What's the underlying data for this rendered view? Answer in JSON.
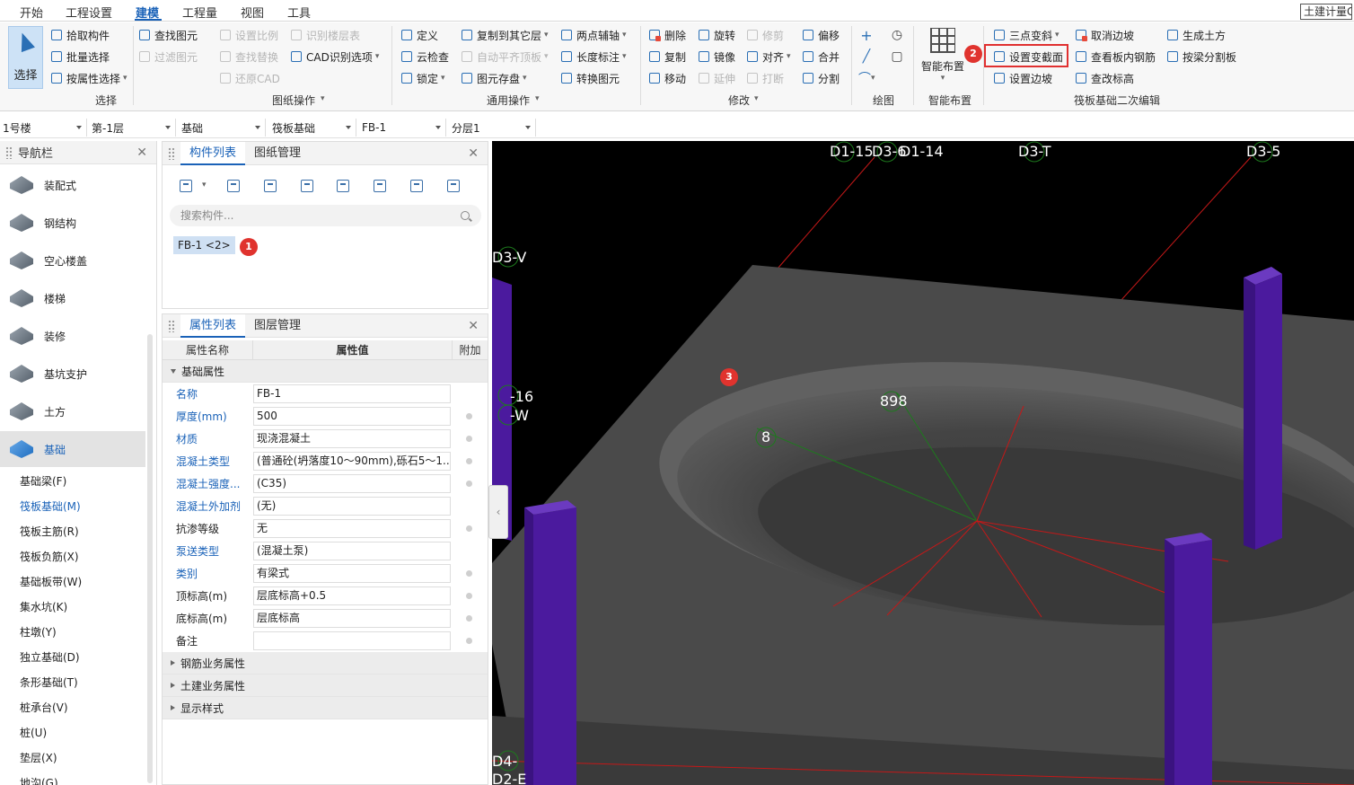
{
  "menu": {
    "tabs": [
      "开始",
      "工程设置",
      "建模",
      "工程量",
      "视图",
      "工具"
    ],
    "active": "建模",
    "right_tab": "土建计量G"
  },
  "ribbon": {
    "select": {
      "big": "选择",
      "pick": "拾取构件",
      "batch": "批量选择",
      "byprop": "按属性选择",
      "label": "选择"
    },
    "drawing": {
      "find_elem": "查找图元",
      "filter_elem": "过滤图元",
      "set_scale": "设置比例",
      "find_replace": "查找替换",
      "restore_cad": "还原CAD",
      "recog_floor": "识别楼层表",
      "cad_options": "CAD识别选项",
      "label": "图纸操作"
    },
    "common": {
      "define": "定义",
      "cloud_check": "云检查",
      "lock": "锁定",
      "copy_other": "复制到其它层",
      "auto_align": "自动平齐顶板",
      "elem_save": "图元存盘",
      "two_point_axis": "两点辅轴",
      "length_dim": "长度标注",
      "convert": "转换图元",
      "label": "通用操作"
    },
    "modify": {
      "delete": "删除",
      "copy": "复制",
      "move": "移动",
      "rotate": "旋转",
      "mirror": "镜像",
      "extend": "延伸",
      "trim": "修剪",
      "align": "对齐",
      "break": "打断",
      "offset": "偏移",
      "merge": "合并",
      "split": "分割",
      "label": "修改"
    },
    "draw": {
      "label": "绘图"
    },
    "smart": {
      "big": "智能布置",
      "label": "智能布置"
    },
    "raft": {
      "three_pt": "三点变斜",
      "set_section": "设置变截面",
      "set_slope": "设置边坡",
      "cancel_slope": "取消边坡",
      "view_rebar": "查看板内钢筋",
      "edit_elev": "查改标高",
      "gen_earth": "生成土方",
      "split_beam": "按梁分割板",
      "label": "筏板基础二次编辑"
    }
  },
  "floorbar": [
    "1号楼",
    "第-1层",
    "基础",
    "筏板基础",
    "FB-1",
    "分层1"
  ],
  "nav": {
    "title": "导航栏",
    "items": [
      "装配式",
      "钢结构",
      "空心楼盖",
      "楼梯",
      "装修",
      "基坑支护",
      "土方",
      "基础"
    ],
    "selected": "基础",
    "subitems": [
      "基础梁(F)",
      "筏板基础(M)",
      "筏板主筋(R)",
      "筏板负筋(X)",
      "基础板带(W)",
      "集水坑(K)",
      "柱墩(Y)",
      "独立基础(D)",
      "条形基础(T)",
      "桩承台(V)",
      "桩(U)",
      "垫层(X)",
      "地沟(G)"
    ],
    "subselected": "筏板基础(M)"
  },
  "component": {
    "tabs": [
      "构件列表",
      "图纸管理"
    ],
    "search_placeholder": "搜索构件...",
    "item": "FB-1 <2>"
  },
  "properties": {
    "tabs": [
      "属性列表",
      "图层管理"
    ],
    "headers": [
      "属性名称",
      "属性值",
      "附加"
    ],
    "group": "基础属性",
    "rows": [
      {
        "name": "名称",
        "value": "FB-1",
        "blue": true,
        "dot": false
      },
      {
        "name": "厚度(mm)",
        "value": "500",
        "blue": true,
        "dot": true
      },
      {
        "name": "材质",
        "value": "现浇混凝土",
        "blue": true,
        "dot": true
      },
      {
        "name": "混凝土类型",
        "value": "(普通砼(坍落度10～90mm),砾石5～1...",
        "blue": true,
        "dot": true
      },
      {
        "name": "混凝土强度...",
        "value": "(C35)",
        "blue": true,
        "dot": true
      },
      {
        "name": "混凝土外加剂",
        "value": "(无)",
        "blue": true,
        "dot": false
      },
      {
        "name": "抗渗等级",
        "value": "无",
        "blue": false,
        "dot": true
      },
      {
        "name": "泵送类型",
        "value": "(混凝土泵)",
        "blue": true,
        "dot": false
      },
      {
        "name": "类别",
        "value": "有梁式",
        "blue": true,
        "dot": true
      },
      {
        "name": "顶标高(m)",
        "value": "层底标高+0.5",
        "blue": false,
        "dot": true
      },
      {
        "name": "底标高(m)",
        "value": "层底标高",
        "blue": false,
        "dot": true
      },
      {
        "name": "备注",
        "value": "",
        "blue": false,
        "dot": true
      }
    ],
    "collapsed_groups": [
      "钢筋业务属性",
      "土建业务属性",
      "显示样式"
    ]
  },
  "viewport": {
    "axis_labels": [
      "D1-15",
      "D3-6",
      "D1-14",
      "D3-T",
      "D3-5",
      "D3-V",
      "-16",
      "-W",
      "898",
      "8",
      "D4-",
      "D2-E"
    ]
  },
  "badges": [
    "1",
    "2",
    "3"
  ],
  "colors": {
    "accent": "#1a62b8",
    "highlight": "#e03030",
    "column": "#4b1a9e",
    "slab": "#4a4a4a"
  }
}
